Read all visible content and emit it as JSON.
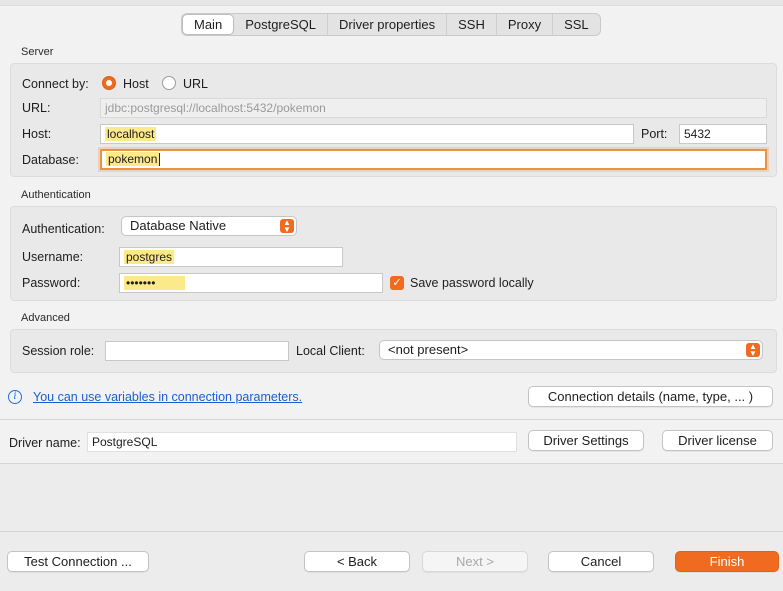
{
  "tabs": [
    "Main",
    "PostgreSQL",
    "Driver properties",
    "SSH",
    "Proxy",
    "SSL"
  ],
  "server": {
    "section_title": "Server",
    "connect_by_label": "Connect by:",
    "option_host": "Host",
    "option_url": "URL",
    "selected": "Host",
    "url_label": "URL:",
    "url_value": "jdbc:postgresql://localhost:5432/pokemon",
    "host_label": "Host:",
    "host_value": "localhost",
    "port_label": "Port:",
    "port_value": "5432",
    "database_label": "Database:",
    "database_value": "pokemon"
  },
  "auth": {
    "section_title": "Authentication",
    "auth_label": "Authentication:",
    "auth_value": "Database Native",
    "username_label": "Username:",
    "username_value": "postgres",
    "password_label": "Password:",
    "password_value": "•••••••",
    "save_password_label": "Save password locally",
    "save_password_checked": true
  },
  "advanced": {
    "section_title": "Advanced",
    "session_role_label": "Session role:",
    "session_role_value": "",
    "local_client_label": "Local Client:",
    "local_client_value": "<not present>"
  },
  "info_link": "You can use variables in connection parameters.",
  "connection_details_button": "Connection details (name, type, ... )",
  "driver": {
    "label": "Driver name:",
    "value": "PostgreSQL",
    "settings_button": "Driver Settings",
    "license_button": "Driver license"
  },
  "footer": {
    "test_button": "Test Connection ...",
    "back_button": "< Back",
    "next_button": "Next >",
    "cancel_button": "Cancel",
    "finish_button": "Finish"
  },
  "colors": {
    "accent": "#f06a1f",
    "highlight": "#fbe98a",
    "link": "#1a5fd0",
    "focus_ring": "#f0913e"
  }
}
